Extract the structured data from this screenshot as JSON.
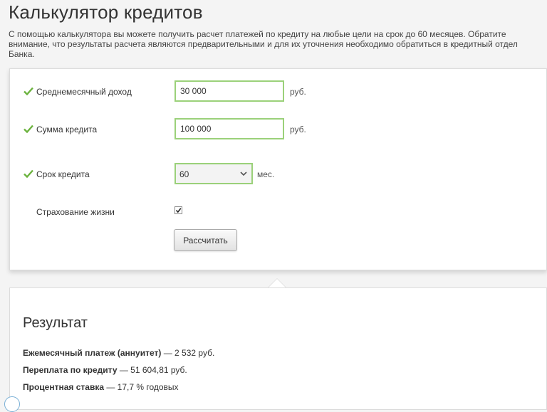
{
  "page": {
    "title": "Калькулятор кредитов",
    "intro": "С помощью калькулятора вы можете получить расчет платежей по кредиту на любые цели на срок до 60 месяцев. Обратите внимание, что результаты расчета являются предварительными и для их уточнения необходимо обратиться в кредитный отдел Банка."
  },
  "form": {
    "income": {
      "label": "Среднемесячный доход",
      "value": "30 000",
      "unit": "руб."
    },
    "amount": {
      "label": "Сумма кредита",
      "value": "100 000",
      "unit": "руб."
    },
    "term": {
      "label": "Срок кредита",
      "value": "60",
      "unit": "мес."
    },
    "insurance": {
      "label": "Страхование жизни",
      "checked": true
    },
    "submit_label": "Рассчитать"
  },
  "result": {
    "title": "Результат",
    "payment": {
      "label": "Ежемесячный платеж (аннуитет)",
      "value": " — 2 532 руб."
    },
    "overpay": {
      "label": "Переплата по кредиту",
      "value": " — 51 604,81 руб."
    },
    "rate": {
      "label": "Процентная ставка",
      "value": " — 17,7 % годовых"
    }
  },
  "colors": {
    "valid_border": "#9bd17a",
    "check": "#6cb33f"
  }
}
